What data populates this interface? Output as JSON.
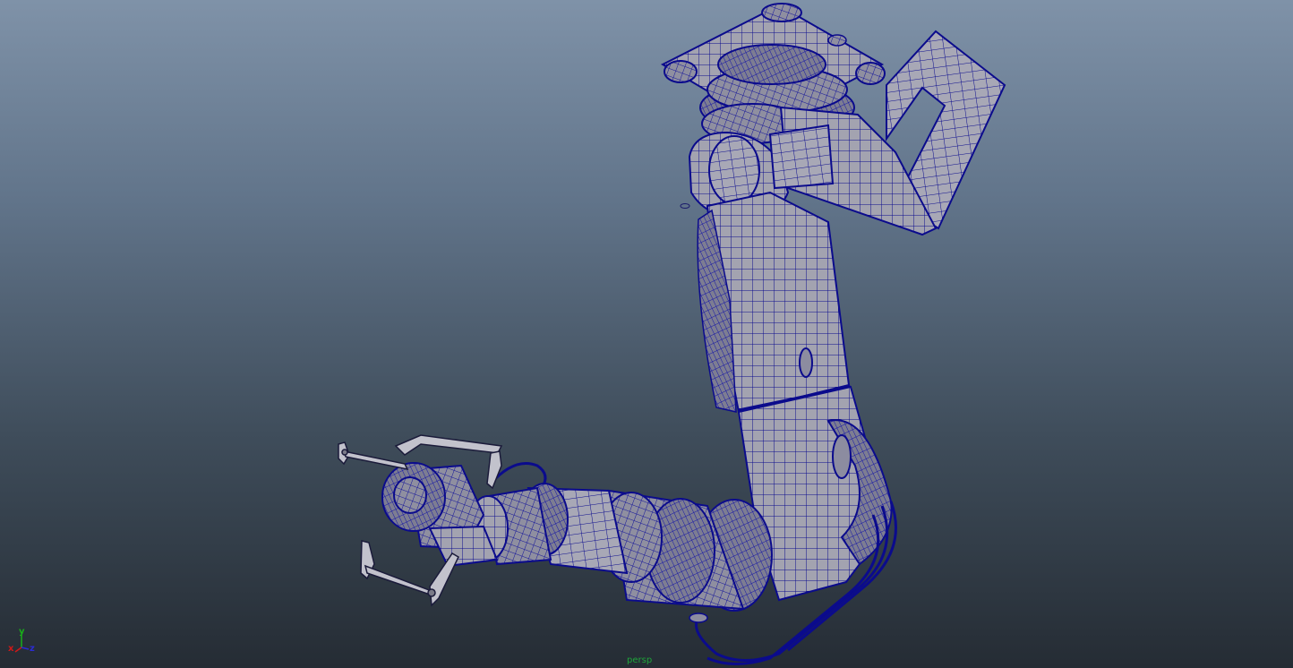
{
  "viewport": {
    "camera_label": "persp",
    "axis": {
      "x": "x",
      "y": "y",
      "z": "z"
    }
  },
  "colors": {
    "wire": "#0b0b8c",
    "surface": "#9c9ca8",
    "surface_light": "#b6b6c2",
    "axis_x": "#d01818",
    "axis_y": "#18b018",
    "axis_z": "#2b2bd4",
    "camera_label": "#1ea43a"
  }
}
